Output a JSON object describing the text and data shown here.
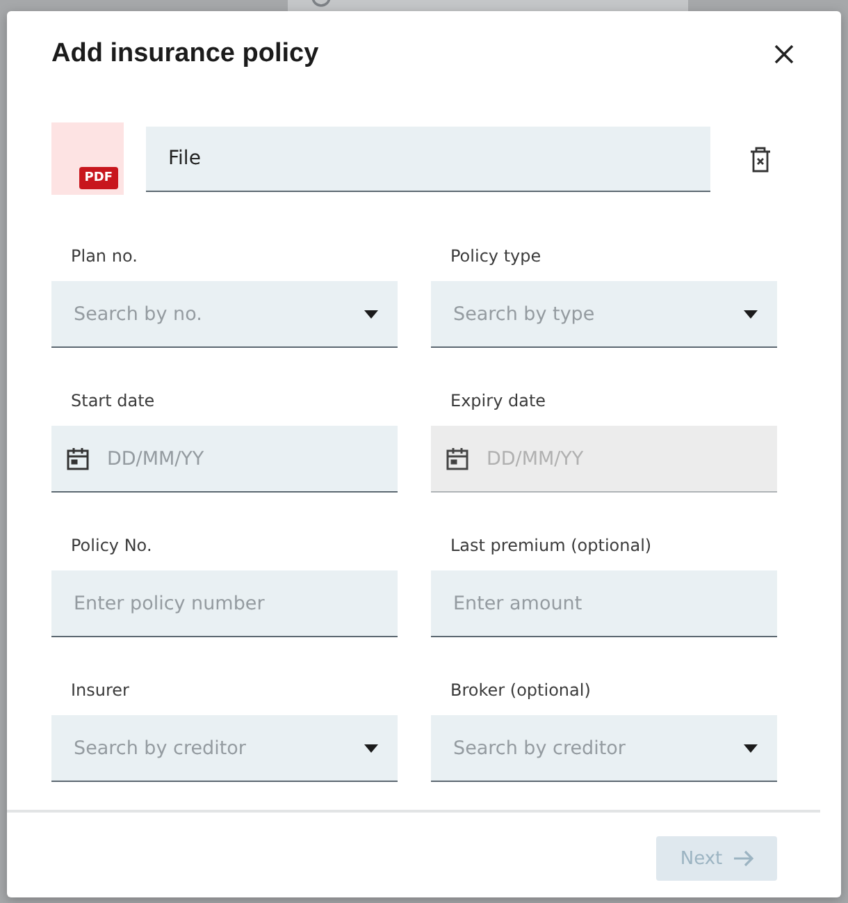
{
  "dialog": {
    "title": "Add insurance policy"
  },
  "file": {
    "badge": "PDF",
    "value": "File"
  },
  "fields": [
    {
      "label": "Plan no.",
      "kind": "select",
      "placeholder": "Search by no.",
      "disabled": false
    },
    {
      "label": "Policy type",
      "kind": "select",
      "placeholder": "Search by type",
      "disabled": false
    },
    {
      "label": "Start date",
      "kind": "date",
      "placeholder": "DD/MM/YY",
      "disabled": false
    },
    {
      "label": "Expiry date",
      "kind": "date",
      "placeholder": "DD/MM/YY",
      "disabled": true
    },
    {
      "label": "Policy No.",
      "kind": "text",
      "placeholder": "Enter policy number",
      "disabled": false
    },
    {
      "label": "Last premium (optional)",
      "kind": "text",
      "placeholder": "Enter amount",
      "disabled": false
    },
    {
      "label": "Insurer",
      "kind": "select",
      "placeholder": "Search by creditor",
      "disabled": false
    },
    {
      "label": "Broker (optional)",
      "kind": "select",
      "placeholder": "Search by creditor",
      "disabled": false
    }
  ],
  "next_button": {
    "label": "Next",
    "disabled": true
  }
}
